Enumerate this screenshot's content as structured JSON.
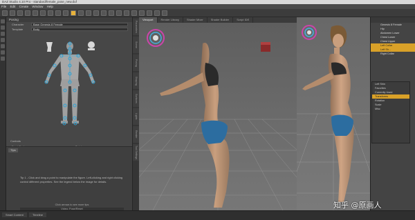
{
  "app": {
    "title": "DAZ Studio 4.10 Pro - standard/female_pose_new.duf"
  },
  "menu": [
    "File",
    "Edit",
    "Create",
    "Window",
    "Help"
  ],
  "left_panel": {
    "header": "Posing",
    "fields": [
      {
        "label": "Character",
        "value": "Base Genesis 8 Female"
      },
      {
        "label": "Template",
        "value": "Body"
      }
    ],
    "pose_controls": [
      {
        "label": "Front Back"
      },
      {
        "label": "Twist"
      },
      {
        "label": "Bend"
      },
      {
        "label": "Twist"
      }
    ],
    "tips": {
      "tab": "Tips",
      "text": "Tip 1 - Click and drag a point to manipulate the figure. Left-clicking and right clicking control different properties. See the legend below the image for details.",
      "footer1": "Click arrows to see more tips",
      "footer2": "Video: Pose/Reset"
    }
  },
  "side_tabs": [
    "Parameters",
    "Scene",
    "Posing",
    "Shaping",
    "Surfaces",
    "Lights",
    "Render Settings",
    "Tool Settings"
  ],
  "viewport": {
    "tabs": [
      "Viewport",
      "Render Library",
      "Shader Mixer",
      "Shader Builder",
      "Script IDE"
    ],
    "active_tab": "Viewport",
    "camera": "Perspective View"
  },
  "scene_panel": {
    "items": [
      {
        "label": "Genesis 8 Female",
        "highlight": false
      },
      {
        "label": "Hip",
        "highlight": false
      },
      {
        "label": "Abdomen Lower",
        "highlight": false
      },
      {
        "label": "Chest Lower",
        "highlight": false
      },
      {
        "label": "Chest Upper",
        "highlight": false
      },
      {
        "label": "Left Collar",
        "highlight": true
      },
      {
        "label": "Left Sh...",
        "highlight": true
      },
      {
        "label": "Right Collar",
        "highlight": false
      }
    ],
    "layers": [
      {
        "label": "Left Shin",
        "sel": false
      },
      {
        "label": "Favorites",
        "sel": false
      },
      {
        "label": "Currently Used",
        "sel": false
      },
      {
        "label": "Transforms",
        "sel": true
      },
      {
        "label": "Rotation",
        "sel": false
      },
      {
        "label": "Scale",
        "sel": false
      },
      {
        "label": "Misc",
        "sel": false
      }
    ]
  },
  "statusbar": {
    "tabs": [
      "Smart Content",
      "Timeline"
    ]
  },
  "watermark": "知乎 @原画人"
}
